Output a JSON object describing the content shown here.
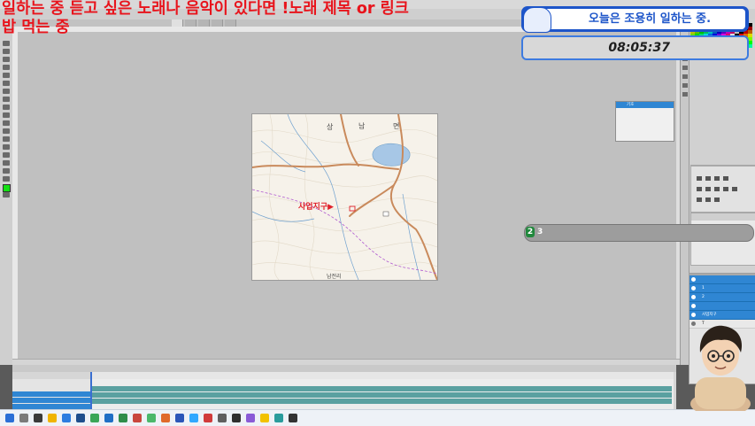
{
  "overlay": {
    "title_line1": "일하는 중 듣고 싶은 노래나 음악이 있다면 !노래 제목 or 링크",
    "title_line2": "밥 먹는 중",
    "banner_text": "오늘은 조용히 일하는 중.",
    "clock": "08:05:37",
    "chat_badge": "2",
    "chat_text": "3"
  },
  "photoshop": {
    "doc_tabs": [
      "",
      "",
      "",
      "",
      ""
    ],
    "doc_status": "",
    "layers": [
      {
        "name": "",
        "selected": true
      },
      {
        "name": "1",
        "selected": true
      },
      {
        "name": "2",
        "selected": true
      },
      {
        "name": "",
        "selected": true
      },
      {
        "name": "사업지구",
        "selected": true
      },
      {
        "name": "T",
        "selected": false
      }
    ],
    "float_panel_rows": [
      "",
      "",
      "",
      "",
      "",
      "",
      "기호"
    ],
    "timeline_header": "",
    "timeline_ticks": [
      "",
      "",
      "",
      "",
      "",
      "",
      "",
      "",
      "",
      ""
    ]
  },
  "map": {
    "site_label": "사업지구▶",
    "labels": {
      "sang": "상",
      "nam": "남",
      "myeon": "면",
      "nam_bottom": "남전리"
    }
  },
  "colors": {
    "banner_blue": "#1d55c9",
    "overlay_red": "#e8141c",
    "layer_selected": "#2f86d3",
    "fg_swatch": "#14e014"
  },
  "taskbar": {
    "time": "",
    "date": ""
  }
}
